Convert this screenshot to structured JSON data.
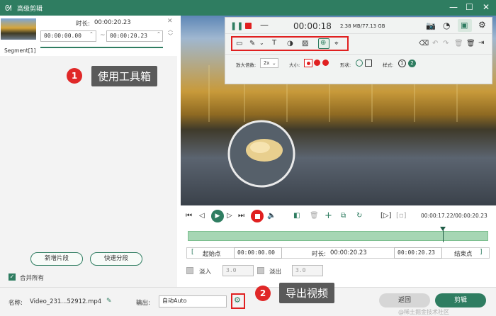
{
  "window": {
    "title": "高级剪辑",
    "logo_icon": "bunny-logo-icon"
  },
  "clip": {
    "duration_label": "时长:",
    "duration_value": "00:00:20.23",
    "start": "00:00:00.00",
    "end": "00:00:20.23",
    "segment_label": "Segment[1]"
  },
  "left_buttons": {
    "add_segment": "新增片段",
    "quick_split": "快速分段",
    "merge_all": "合并所有"
  },
  "recorder": {
    "timer": "00:00:18",
    "storage": "2.38 MB/77.13 GB"
  },
  "tool_options": {
    "zoom_label": "放大倍数:",
    "zoom_value": "2x",
    "size_label": "大小:",
    "shape_label": "形状:",
    "style_label": "样式:",
    "style_1": "1",
    "style_2": "2"
  },
  "playback": {
    "time": "00:00:17.22/00:00:20.23",
    "playhead_fraction": 0.85
  },
  "range": {
    "start_label": "起始点",
    "start_value": "00:00:00.00",
    "duration_label": "时长:",
    "duration_value": "00:00:20.23",
    "end_value": "00:00:20.23",
    "end_label": "结束点"
  },
  "fade": {
    "fade_in_label": "淡入",
    "fade_in_value": "3.0",
    "fade_out_label": "淡出",
    "fade_out_value": "3.0"
  },
  "footer": {
    "name_label": "名称:",
    "name_value": "Video_231...52912.mp4",
    "output_label": "输出:",
    "output_value": "自动Auto",
    "back": "返回",
    "edit": "剪辑"
  },
  "callouts": {
    "c1_num": "1",
    "c1_text": "使用工具箱",
    "c2_num": "2",
    "c2_text": "导出视频"
  },
  "watermark": "@稀土掘金技术社区",
  "colors": {
    "brand": "#2f7d61",
    "record_red": "#e02020",
    "track_green": "#a6d6b4"
  }
}
